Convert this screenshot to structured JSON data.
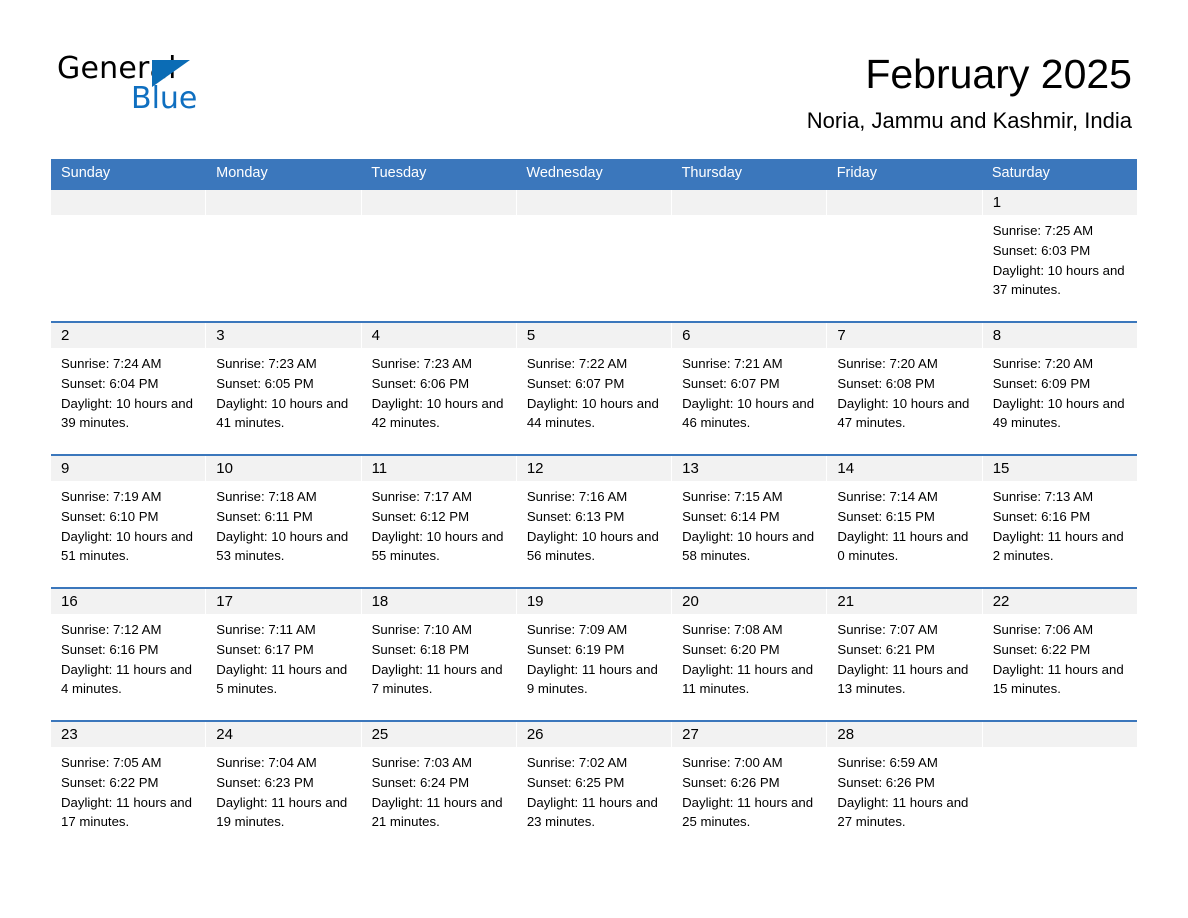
{
  "brand": {
    "name_part1": "General",
    "name_part2": "Blue",
    "flag_icon": "triangle-flag-icon",
    "accent_color": "#0f6fc0"
  },
  "header": {
    "month_title": "February 2025",
    "location": "Noria, Jammu and Kashmir, India"
  },
  "theme": {
    "header_blue": "#3b77bc",
    "day_band_gray": "#f2f2f2",
    "row_border_blue": "#3b77bc"
  },
  "calendar": {
    "weekdays": [
      "Sunday",
      "Monday",
      "Tuesday",
      "Wednesday",
      "Thursday",
      "Friday",
      "Saturday"
    ],
    "weeks": [
      [
        {
          "day": "",
          "lines": []
        },
        {
          "day": "",
          "lines": []
        },
        {
          "day": "",
          "lines": []
        },
        {
          "day": "",
          "lines": []
        },
        {
          "day": "",
          "lines": []
        },
        {
          "day": "",
          "lines": []
        },
        {
          "day": "1",
          "lines": [
            "Sunrise: 7:25 AM",
            "Sunset: 6:03 PM",
            "Daylight: 10 hours and 37 minutes."
          ]
        }
      ],
      [
        {
          "day": "2",
          "lines": [
            "Sunrise: 7:24 AM",
            "Sunset: 6:04 PM",
            "Daylight: 10 hours and 39 minutes."
          ]
        },
        {
          "day": "3",
          "lines": [
            "Sunrise: 7:23 AM",
            "Sunset: 6:05 PM",
            "Daylight: 10 hours and 41 minutes."
          ]
        },
        {
          "day": "4",
          "lines": [
            "Sunrise: 7:23 AM",
            "Sunset: 6:06 PM",
            "Daylight: 10 hours and 42 minutes."
          ]
        },
        {
          "day": "5",
          "lines": [
            "Sunrise: 7:22 AM",
            "Sunset: 6:07 PM",
            "Daylight: 10 hours and 44 minutes."
          ]
        },
        {
          "day": "6",
          "lines": [
            "Sunrise: 7:21 AM",
            "Sunset: 6:07 PM",
            "Daylight: 10 hours and 46 minutes."
          ]
        },
        {
          "day": "7",
          "lines": [
            "Sunrise: 7:20 AM",
            "Sunset: 6:08 PM",
            "Daylight: 10 hours and 47 minutes."
          ]
        },
        {
          "day": "8",
          "lines": [
            "Sunrise: 7:20 AM",
            "Sunset: 6:09 PM",
            "Daylight: 10 hours and 49 minutes."
          ]
        }
      ],
      [
        {
          "day": "9",
          "lines": [
            "Sunrise: 7:19 AM",
            "Sunset: 6:10 PM",
            "Daylight: 10 hours and 51 minutes."
          ]
        },
        {
          "day": "10",
          "lines": [
            "Sunrise: 7:18 AM",
            "Sunset: 6:11 PM",
            "Daylight: 10 hours and 53 minutes."
          ]
        },
        {
          "day": "11",
          "lines": [
            "Sunrise: 7:17 AM",
            "Sunset: 6:12 PM",
            "Daylight: 10 hours and 55 minutes."
          ]
        },
        {
          "day": "12",
          "lines": [
            "Sunrise: 7:16 AM",
            "Sunset: 6:13 PM",
            "Daylight: 10 hours and 56 minutes."
          ]
        },
        {
          "day": "13",
          "lines": [
            "Sunrise: 7:15 AM",
            "Sunset: 6:14 PM",
            "Daylight: 10 hours and 58 minutes."
          ]
        },
        {
          "day": "14",
          "lines": [
            "Sunrise: 7:14 AM",
            "Sunset: 6:15 PM",
            "Daylight: 11 hours and 0 minutes."
          ]
        },
        {
          "day": "15",
          "lines": [
            "Sunrise: 7:13 AM",
            "Sunset: 6:16 PM",
            "Daylight: 11 hours and 2 minutes."
          ]
        }
      ],
      [
        {
          "day": "16",
          "lines": [
            "Sunrise: 7:12 AM",
            "Sunset: 6:16 PM",
            "Daylight: 11 hours and 4 minutes."
          ]
        },
        {
          "day": "17",
          "lines": [
            "Sunrise: 7:11 AM",
            "Sunset: 6:17 PM",
            "Daylight: 11 hours and 5 minutes."
          ]
        },
        {
          "day": "18",
          "lines": [
            "Sunrise: 7:10 AM",
            "Sunset: 6:18 PM",
            "Daylight: 11 hours and 7 minutes."
          ]
        },
        {
          "day": "19",
          "lines": [
            "Sunrise: 7:09 AM",
            "Sunset: 6:19 PM",
            "Daylight: 11 hours and 9 minutes."
          ]
        },
        {
          "day": "20",
          "lines": [
            "Sunrise: 7:08 AM",
            "Sunset: 6:20 PM",
            "Daylight: 11 hours and 11 minutes."
          ]
        },
        {
          "day": "21",
          "lines": [
            "Sunrise: 7:07 AM",
            "Sunset: 6:21 PM",
            "Daylight: 11 hours and 13 minutes."
          ]
        },
        {
          "day": "22",
          "lines": [
            "Sunrise: 7:06 AM",
            "Sunset: 6:22 PM",
            "Daylight: 11 hours and 15 minutes."
          ]
        }
      ],
      [
        {
          "day": "23",
          "lines": [
            "Sunrise: 7:05 AM",
            "Sunset: 6:22 PM",
            "Daylight: 11 hours and 17 minutes."
          ]
        },
        {
          "day": "24",
          "lines": [
            "Sunrise: 7:04 AM",
            "Sunset: 6:23 PM",
            "Daylight: 11 hours and 19 minutes."
          ]
        },
        {
          "day": "25",
          "lines": [
            "Sunrise: 7:03 AM",
            "Sunset: 6:24 PM",
            "Daylight: 11 hours and 21 minutes."
          ]
        },
        {
          "day": "26",
          "lines": [
            "Sunrise: 7:02 AM",
            "Sunset: 6:25 PM",
            "Daylight: 11 hours and 23 minutes."
          ]
        },
        {
          "day": "27",
          "lines": [
            "Sunrise: 7:00 AM",
            "Sunset: 6:26 PM",
            "Daylight: 11 hours and 25 minutes."
          ]
        },
        {
          "day": "28",
          "lines": [
            "Sunrise: 6:59 AM",
            "Sunset: 6:26 PM",
            "Daylight: 11 hours and 27 minutes."
          ]
        },
        {
          "day": "",
          "lines": []
        }
      ]
    ]
  }
}
